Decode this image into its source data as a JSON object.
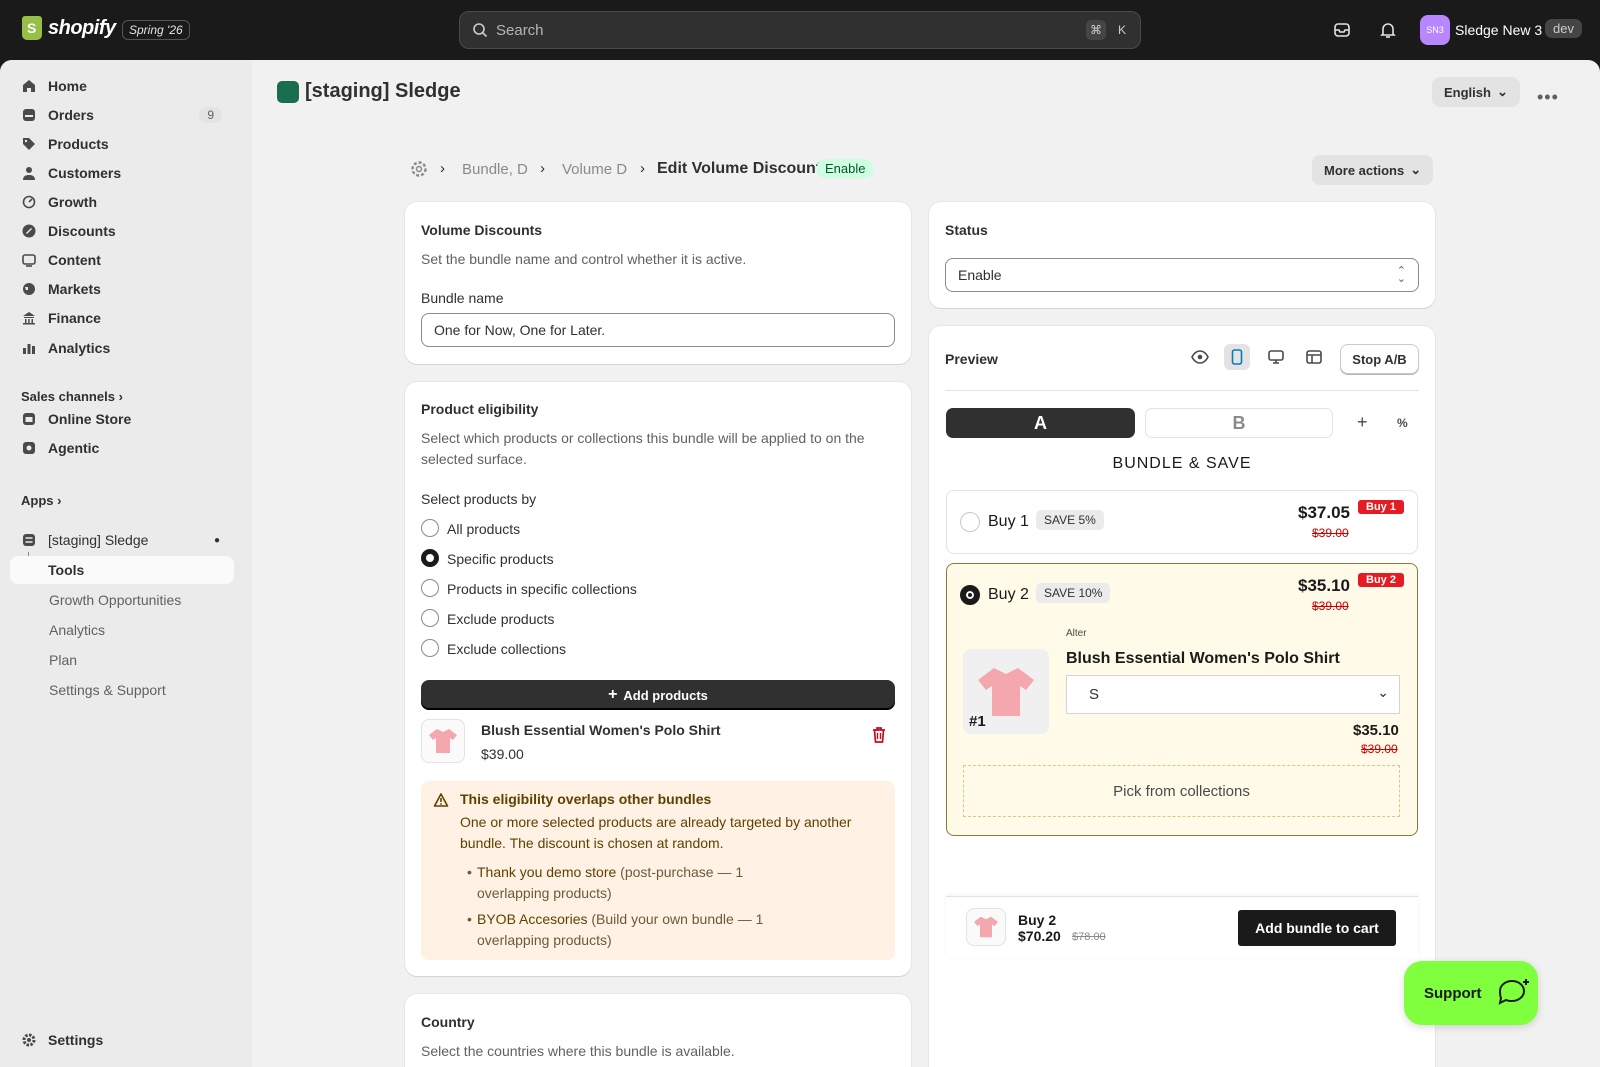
{
  "topbar": {
    "logo_text": "shopify",
    "edition": "Spring '26",
    "search_placeholder": "Search",
    "kbd_cmd": "⌘",
    "kbd_k": "K",
    "avatar_initials": "SN3",
    "store_name": "Sledge New 3",
    "env_badge": "dev"
  },
  "sidebar": {
    "items": [
      {
        "label": "Home",
        "icon": "home-icon"
      },
      {
        "label": "Orders",
        "icon": "orders-icon",
        "badge": "9"
      },
      {
        "label": "Products",
        "icon": "tag-icon"
      },
      {
        "label": "Customers",
        "icon": "person-icon"
      },
      {
        "label": "Growth",
        "icon": "growth-icon"
      },
      {
        "label": "Discounts",
        "icon": "discount-icon"
      },
      {
        "label": "Content",
        "icon": "content-icon"
      },
      {
        "label": "Markets",
        "icon": "globe-icon"
      },
      {
        "label": "Finance",
        "icon": "bank-icon"
      },
      {
        "label": "Analytics",
        "icon": "chart-icon"
      }
    ],
    "sales_channels_label": "Sales channels",
    "channels": [
      {
        "label": "Online Store",
        "icon": "store-icon"
      },
      {
        "label": "Agentic",
        "icon": "agentic-icon"
      }
    ],
    "apps_label": "Apps",
    "app_name": "[staging] Sledge",
    "app_subitems": [
      "Tools",
      "Growth Opportunities",
      "Analytics",
      "Plan",
      "Settings & Support"
    ],
    "settings_label": "Settings"
  },
  "header": {
    "app_title": "[staging] Sledge",
    "language": "English",
    "breadcrumb_1": "Bundle, D",
    "breadcrumb_2": "Volume D",
    "page_title": "Edit Volume Discount",
    "status_badge": "Enable",
    "more_actions": "More actions"
  },
  "volume_card": {
    "title": "Volume Discounts",
    "description": "Set the bundle name and control whether it is active.",
    "name_label": "Bundle name",
    "name_value": "One for Now, One for Later."
  },
  "eligibility_card": {
    "title": "Product eligibility",
    "description": "Select which products or collections this bundle will be applied to on the selected surface.",
    "select_by_label": "Select products by",
    "options": [
      "All products",
      "Specific products",
      "Products in specific collections",
      "Exclude products",
      "Exclude collections"
    ],
    "selected_index": 1,
    "add_button": "Add products",
    "product_name": "Blush Essential Women's Polo Shirt",
    "product_price": "$39.00",
    "warning_title": "This eligibility overlaps other bundles",
    "warning_text": "One or more selected products are already targeted by another bundle. The discount is chosen at random.",
    "overlap_1_link": "Thank you demo store",
    "overlap_1_rest": " (post-purchase — 1 overlapping products)",
    "overlap_2_link": "BYOB Accesories",
    "overlap_2_rest": " (Build your own bundle — 1 overlapping products)"
  },
  "country_card": {
    "title": "Country",
    "description": "Select the countries where this bundle is available."
  },
  "status_card": {
    "title": "Status",
    "value": "Enable"
  },
  "preview": {
    "title": "Preview",
    "stop_ab": "Stop A/B",
    "tab_a": "A",
    "tab_b": "B",
    "plus": "+",
    "percent": "%",
    "heading": "BUNDLE & SAVE",
    "tier1": {
      "label": "Buy 1",
      "save": "SAVE 5%",
      "price": "$37.05",
      "compare": "$39.00",
      "tag": "Buy 1"
    },
    "tier2": {
      "label": "Buy 2",
      "save": "SAVE 10%",
      "price": "$35.10",
      "compare": "$39.00",
      "tag": "Buy 2",
      "vendor": "Alter",
      "product": "Blush Essential Women's Polo Shirt",
      "variant": "S",
      "rank": "#1",
      "item_price": "$35.10",
      "item_compare": "$39.00",
      "pick_label": "Pick from collections"
    },
    "footer": {
      "qty": "Buy 2",
      "price": "$70.20",
      "compare": "$78.00",
      "cta": "Add bundle to cart"
    }
  },
  "support_label": "Support",
  "colors": {
    "accent_green": "#7fff3e",
    "badge_green": "#cdfee1",
    "tier_selected_bg": "#fffbe8",
    "sale_red": "#e51c23"
  }
}
